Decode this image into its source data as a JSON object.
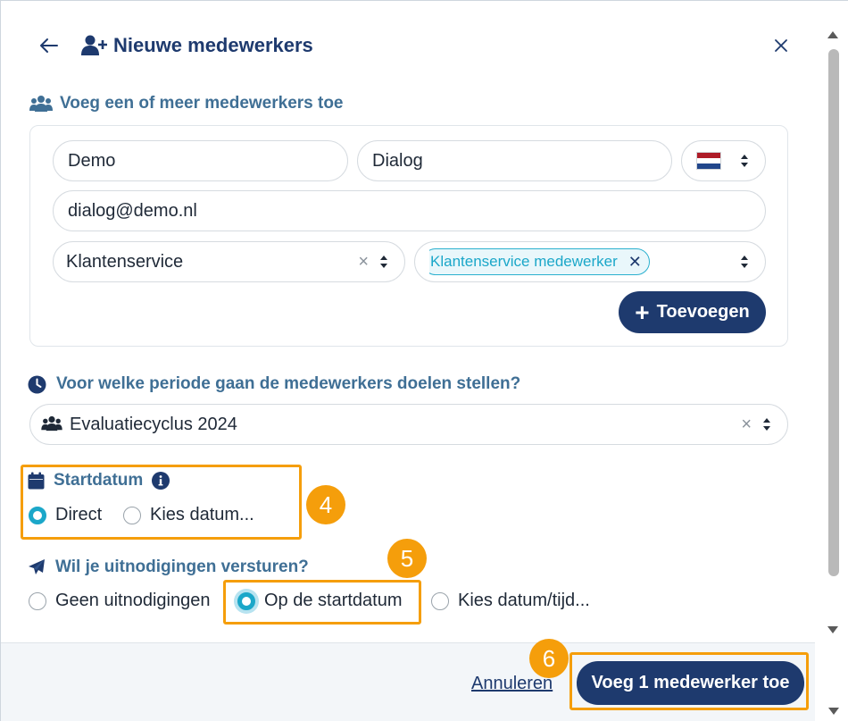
{
  "header": {
    "title": "Nieuwe medewerkers",
    "back_icon": "arrow-left-icon",
    "user_plus_icon": "user-plus-icon",
    "close_icon": "close-icon"
  },
  "add_section": {
    "label": "Voeg een of meer medewerkers toe",
    "icon": "users-icon",
    "first_name": "Demo",
    "last_name": "Dialog",
    "language_flag": "nl-flag-icon",
    "email": "dialog@demo.nl",
    "department": "Klantenservice",
    "role_tag": "Klantenservice medewerker",
    "clear_symbol": "×",
    "tag_remove_symbol": "✕",
    "add_button": "Toevoegen",
    "add_button_icon": "+"
  },
  "period_section": {
    "label": "Voor welke periode gaan de medewerkers doelen stellen?",
    "icon": "clock-icon",
    "value": "Evaluatiecyclus 2024",
    "value_icon": "users-icon",
    "clear_symbol": "×"
  },
  "start_section": {
    "label": "Startdatum",
    "icon": "calendar-icon",
    "info_icon": "info-icon",
    "options": [
      "Direct",
      "Kies datum..."
    ],
    "selected": "Direct"
  },
  "invite_section": {
    "label": "Wil je uitnodigingen versturen?",
    "icon": "paper-plane-icon",
    "options": [
      "Geen uitnodigingen",
      "Op de startdatum",
      "Kies datum/tijd..."
    ],
    "selected": "Op de startdatum"
  },
  "annotations": {
    "badge_4": "4",
    "badge_5": "5",
    "badge_6": "6"
  },
  "footer": {
    "cancel": "Annuleren",
    "submit": "Voeg 1 medewerker toe"
  },
  "colors": {
    "primary": "#1e3a6e",
    "accent": "#1ba7c9",
    "highlight": "#f59e0b",
    "label": "#3f6f95"
  }
}
